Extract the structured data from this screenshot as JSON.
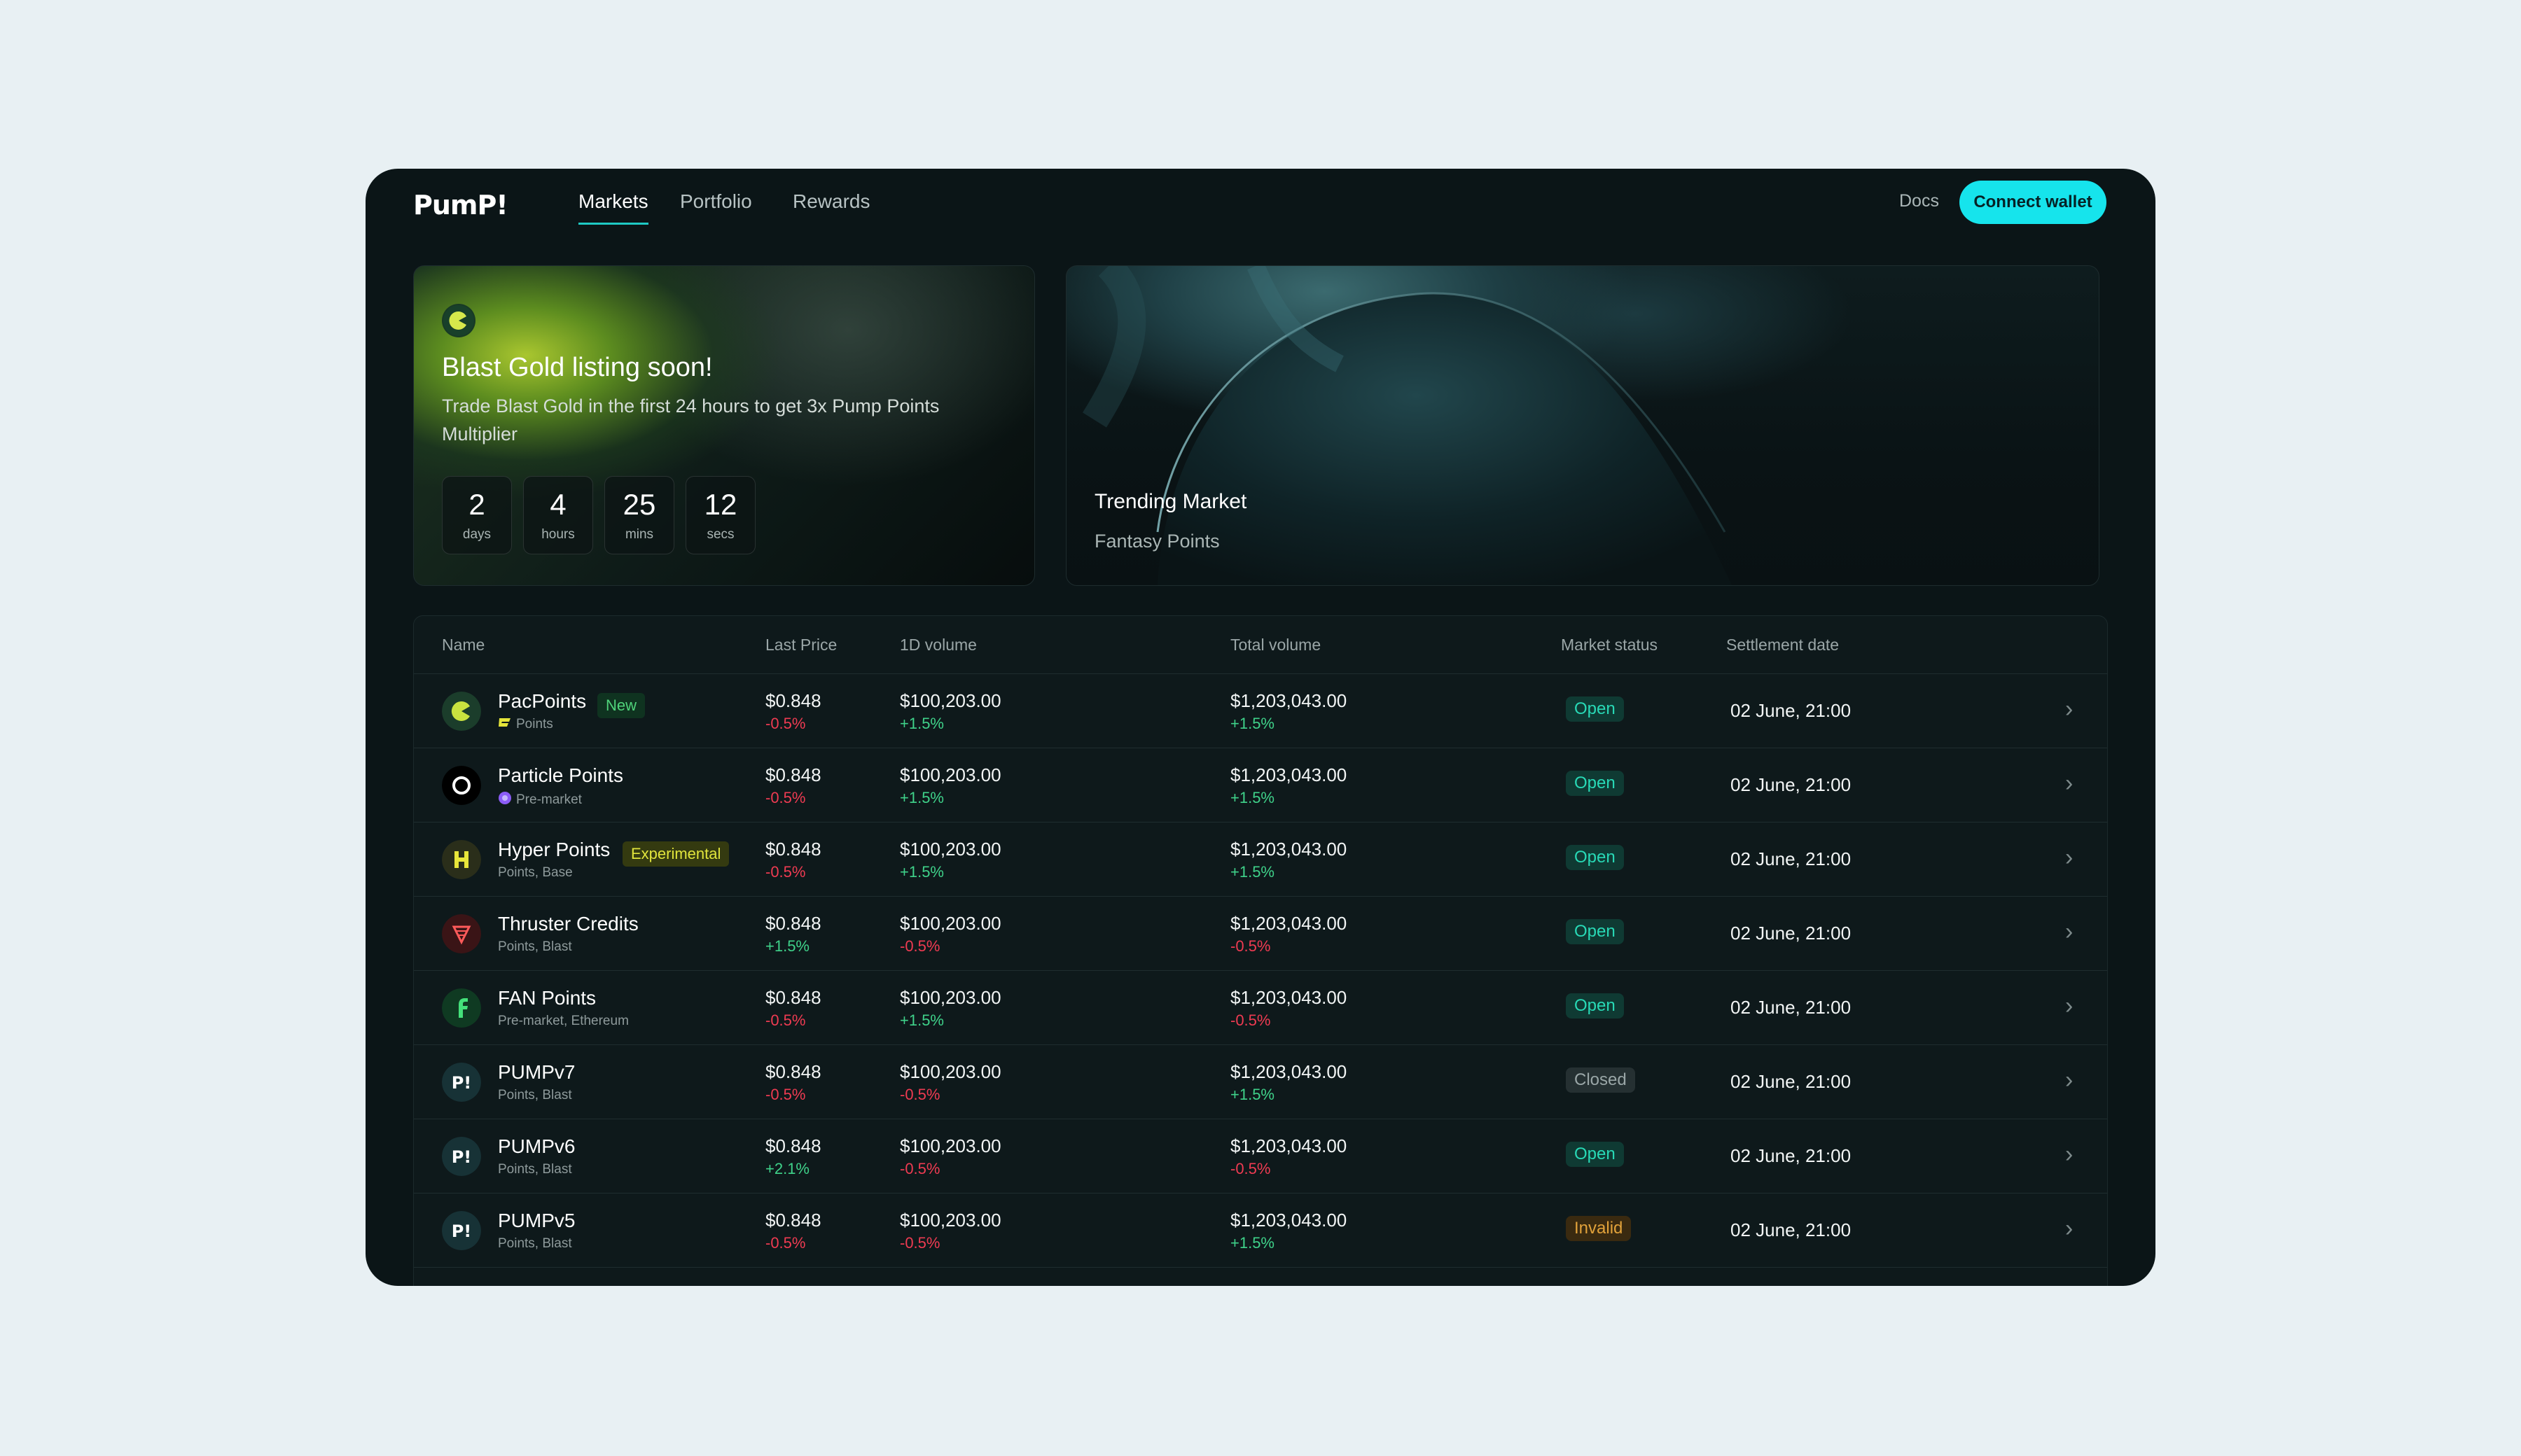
{
  "app": {
    "logo": "PumP!"
  },
  "nav": {
    "tabs": [
      {
        "label": "Markets",
        "active": true
      },
      {
        "label": "Portfolio",
        "active": false
      },
      {
        "label": "Rewards",
        "active": false
      }
    ],
    "docs_label": "Docs",
    "connect_label": "Connect wallet"
  },
  "promo": {
    "icon": "pacman-icon",
    "title": "Blast Gold listing soon!",
    "description": "Trade Blast Gold in the first 24 hours to get 3x Pump Points Multiplier",
    "countdown": [
      {
        "value": "2",
        "unit": "days"
      },
      {
        "value": "4",
        "unit": "hours"
      },
      {
        "value": "25",
        "unit": "mins"
      },
      {
        "value": "12",
        "unit": "secs"
      }
    ]
  },
  "trending": {
    "title": "Trending Market",
    "subtitle": "Fantasy Points"
  },
  "table": {
    "headers": {
      "name": "Name",
      "last_price": "Last Price",
      "one_d_volume": "1D  volume",
      "total_volume": "Total volume",
      "market_status": "Market status",
      "settlement_date": "Settlement date"
    },
    "rows": [
      {
        "icon": "pacman-icon",
        "name": "PacPoints",
        "sub": "Points",
        "sub_icon": "blast-icon",
        "tag": "New",
        "tag_type": "new",
        "price": "$0.848",
        "price_chg": "-0.5%",
        "vol1d": "$100,203.00",
        "vol1d_chg": "+1.5%",
        "total": "$1,203,043.00",
        "total_chg": "+1.5%",
        "status": "Open",
        "status_type": "open",
        "settle": "02 June, 21:00"
      },
      {
        "icon": "ring-icon",
        "name": "Particle Points",
        "sub": "Pre-market",
        "sub_icon": "particle-icon",
        "tag": "",
        "tag_type": "",
        "price": "$0.848",
        "price_chg": "-0.5%",
        "vol1d": "$100,203.00",
        "vol1d_chg": "+1.5%",
        "total": "$1,203,043.00",
        "total_chg": "+1.5%",
        "status": "Open",
        "status_type": "open",
        "settle": "02 June, 21:00"
      },
      {
        "icon": "hyper-icon",
        "name": "Hyper Points",
        "sub": "Points, Base",
        "sub_icon": "",
        "tag": "Experimental",
        "tag_type": "experimental",
        "price": "$0.848",
        "price_chg": "-0.5%",
        "vol1d": "$100,203.00",
        "vol1d_chg": "+1.5%",
        "total": "$1,203,043.00",
        "total_chg": "+1.5%",
        "status": "Open",
        "status_type": "open",
        "settle": "02 June, 21:00"
      },
      {
        "icon": "thruster-icon",
        "name": "Thruster Credits",
        "sub": "Points, Blast",
        "sub_icon": "",
        "tag": "",
        "tag_type": "",
        "price": "$0.848",
        "price_chg": "+1.5%",
        "vol1d": "$100,203.00",
        "vol1d_chg": "-0.5%",
        "total": "$1,203,043.00",
        "total_chg": "-0.5%",
        "status": "Open",
        "status_type": "open",
        "settle": "02 June, 21:00"
      },
      {
        "icon": "fan-icon",
        "name": "FAN Points",
        "sub": "Pre-market, Ethereum",
        "sub_icon": "",
        "tag": "",
        "tag_type": "",
        "price": "$0.848",
        "price_chg": "-0.5%",
        "vol1d": "$100,203.00",
        "vol1d_chg": "+1.5%",
        "total": "$1,203,043.00",
        "total_chg": "-0.5%",
        "status": "Open",
        "status_type": "open",
        "settle": "02 June, 21:00"
      },
      {
        "icon": "pump-icon",
        "name": "PUMPv7",
        "sub": "Points, Blast",
        "sub_icon": "",
        "tag": "",
        "tag_type": "",
        "price": "$0.848",
        "price_chg": "-0.5%",
        "vol1d": "$100,203.00",
        "vol1d_chg": "-0.5%",
        "total": "$1,203,043.00",
        "total_chg": "+1.5%",
        "status": "Closed",
        "status_type": "closed",
        "settle": "02 June, 21:00"
      },
      {
        "icon": "pump-icon",
        "name": "PUMPv6",
        "sub": "Points, Blast",
        "sub_icon": "",
        "tag": "",
        "tag_type": "",
        "price": "$0.848",
        "price_chg": "+2.1%",
        "vol1d": "$100,203.00",
        "vol1d_chg": "-0.5%",
        "total": "$1,203,043.00",
        "total_chg": "-0.5%",
        "status": "Open",
        "status_type": "open",
        "settle": "02 June, 21:00"
      },
      {
        "icon": "pump-icon",
        "name": "PUMPv5",
        "sub": "Points, Blast",
        "sub_icon": "",
        "tag": "",
        "tag_type": "",
        "price": "$0.848",
        "price_chg": "-0.5%",
        "vol1d": "$100,203.00",
        "vol1d_chg": "-0.5%",
        "total": "$1,203,043.00",
        "total_chg": "+1.5%",
        "status": "Invalid",
        "status_type": "invalid",
        "settle": "02 June, 21:00"
      }
    ]
  },
  "colors": {
    "accent": "#16e4ec",
    "positive": "#3fd28a",
    "negative": "#ef3b52",
    "open_status": "#28d9b6",
    "invalid_status": "#e2a23a"
  }
}
